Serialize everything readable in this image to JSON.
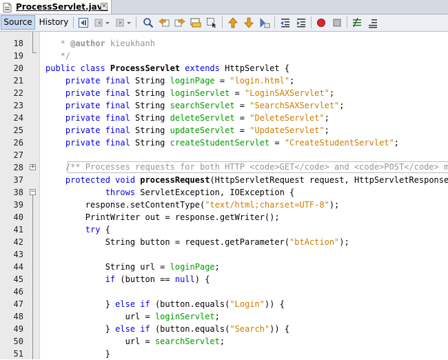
{
  "file_tab": {
    "title": "ProcessServlet.java"
  },
  "toolbar": {
    "source_label": "Source",
    "history_label": "History",
    "icons": [
      "last-edit-icon",
      "back-icon",
      "forward-icon",
      "find-icon",
      "find-previous-icon",
      "find-next-icon",
      "toggle-highlight-icon",
      "select-icon",
      "previous-bookmark-icon",
      "next-bookmark-icon",
      "toggle-bookmark-icon",
      "shift-left-icon",
      "shift-right-icon",
      "start-macro-icon",
      "stop-macro-icon",
      "comment-icon",
      "uncomment-icon"
    ]
  },
  "editor": {
    "lines": [
      {
        "n": "18",
        "y": 0
      },
      {
        "n": "19"
      },
      {
        "n": "20"
      },
      {
        "n": "21"
      },
      {
        "n": "22"
      },
      {
        "n": "23"
      },
      {
        "n": "24"
      },
      {
        "n": "25"
      },
      {
        "n": "26"
      },
      {
        "n": "27"
      },
      {
        "n": "28"
      },
      {
        "n": "37"
      },
      {
        "n": "38"
      },
      {
        "n": "39"
      },
      {
        "n": "40"
      },
      {
        "n": "41"
      },
      {
        "n": "42"
      },
      {
        "n": "43"
      },
      {
        "n": "44"
      },
      {
        "n": "45"
      },
      {
        "n": "46"
      },
      {
        "n": "47"
      },
      {
        "n": "48"
      },
      {
        "n": "49"
      },
      {
        "n": "50"
      },
      {
        "n": "51"
      }
    ],
    "code": {
      "l18_a": "   * ",
      "l18_b": "@author",
      "l18_c": " kieukhanh",
      "l19": "   */",
      "l20_a": "public class ",
      "l20_b": "ProcessServlet",
      "l20_c": " extends ",
      "l20_d": "HttpServlet {",
      "decl_prefix": "    private final ",
      "decl_type": "String ",
      "l21_name": "loginPage",
      "l21_val": "\"login.html\"",
      "l22_name": "loginServlet",
      "l22_val": "\"LoginSAXServlet\"",
      "l23_name": "searchServlet",
      "l23_val": "\"SearchSAXServlet\"",
      "l24_name": "deleteServlet",
      "l24_val": "\"DeleteServlet\"",
      "l25_name": "updateServlet",
      "l25_val": "\"UpdateServlet\"",
      "l26_name": "createStudentServlet",
      "l26_val": "\"CreateStudentServlet\"",
      "eq": " = ",
      "semi": ";",
      "l28": "    /** Processes requests for both HTTP <code>GET</code> and <code>POST</code> methods.",
      "l37_a": "    protected void ",
      "l37_b": "processRequest",
      "l37_c": "(HttpServletRequest request, HttpServletResponse response)",
      "l38_a": "            throws ",
      "l38_b": "ServletException, IOException {",
      "l39_a": "        response.setContentType(",
      "l39_b": "\"text/html;charset=UTF-8\"",
      "l39_c": ");",
      "l40": "        PrintWriter out = response.getWriter();",
      "l41_a": "        try",
      "l41_b": " {",
      "l42_a": "            String button = request.getParameter(",
      "l42_b": "\"btAction\"",
      "l42_c": ");",
      "l44_a": "            String url = ",
      "l44_b": "loginPage",
      "l44_c": ";",
      "l45_a": "            if",
      "l45_b": " (button == ",
      "l45_c": "null",
      "l45_d": ") {",
      "l47_a": "            } ",
      "l47_b": "else if",
      "l47_c": " (button.equals(",
      "l47_d": "\"Login\"",
      "l47_e": ")) {",
      "l48_a": "                url = ",
      "l48_b": "loginServlet",
      "l48_c": ";",
      "l49_a": "            } ",
      "l49_b": "else if",
      "l49_c": " (button.equals(",
      "l49_d": "\"Search\"",
      "l49_e": ")) {",
      "l50_a": "                url = ",
      "l50_b": "searchServlet",
      "l50_c": ";",
      "l51": "            }"
    }
  },
  "colors": {
    "keyword": "#0000e6",
    "field": "#009900",
    "string": "#ce7b00",
    "comment": "#969696"
  }
}
